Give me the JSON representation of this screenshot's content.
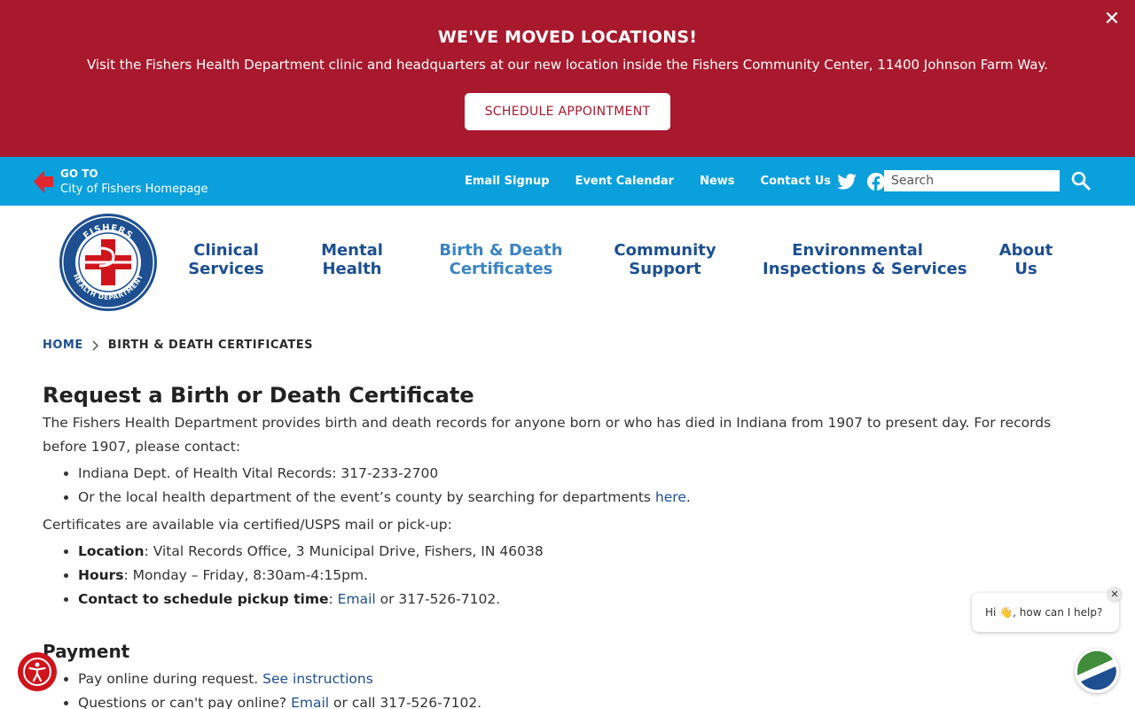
{
  "alert": {
    "title": "WE'VE MOVED LOCATIONS!",
    "text": "Visit the Fishers Health Department clinic and headquarters at our new location inside the Fishers Community Center, 11400 Johnson Farm Way.",
    "button_label": "SCHEDULE APPOINTMENT",
    "close_label": "✕"
  },
  "utility_bar": {
    "goto_top": "GO TO",
    "goto_bottom": "City of Fishers Homepage",
    "links": [
      "Email Signup",
      "Event Calendar",
      "News",
      "Contact Us"
    ],
    "social_icons": [
      "twitter-icon",
      "facebook-icon",
      "youtube-icon"
    ],
    "search_placeholder": "Search"
  },
  "logo": {
    "top_text": "FISHERS",
    "bottom_text": "HEALTH DEPARTMENT"
  },
  "nav": {
    "items": [
      {
        "line1": "Clinical",
        "line2": "Services"
      },
      {
        "line1": "Mental",
        "line2": "Health"
      },
      {
        "line1": "Birth & Death",
        "line2": "Certificates"
      },
      {
        "line1": "Community",
        "line2": "Support"
      },
      {
        "line1": "Environmental",
        "line2": "Inspections & Services"
      },
      {
        "line1": "About",
        "line2": "Us"
      }
    ],
    "active_index": 2
  },
  "breadcrumb": {
    "home": "HOME",
    "current": "BIRTH & DEATH CERTIFICATES"
  },
  "content": {
    "title": "Request a Birth or Death Certificate",
    "intro": "The Fishers Health Department provides birth and death records for anyone born or who has died in Indiana from 1907 to present day. For records before 1907, please contact:",
    "contacts": {
      "item1": "Indiana Dept. of Health Vital Records: 317-233-2700",
      "item2_text": "Or the local health department of the event’s county by searching for departments ",
      "item2_link": "here",
      "item2_end": "."
    },
    "availability": "Certificates are available via certified/USPS mail or pick-up:",
    "details": {
      "location_label": "Location",
      "location_value": ": Vital Records Office, 3 Municipal Drive, Fishers, IN 46038",
      "hours_label": "Hours",
      "hours_value": ": Monday – Friday, 8:30am-4:15pm.",
      "contact_label": "Contact to schedule pickup time",
      "contact_sep": ": ",
      "contact_link": "Email",
      "contact_end": " or 317-526-7102."
    },
    "payment": {
      "title": "Payment",
      "item1_text": "Pay online during request. ",
      "item1_link": "See instructions",
      "item2_text": "Questions or can't pay online? ",
      "item2_link": "Email",
      "item2_end": " or call 317-526-7102."
    }
  },
  "chat": {
    "greeting": "Hi 👋, how can I help?",
    "close_label": "✕"
  },
  "colors": {
    "alert_bg": "#a8192e",
    "utility_bg": "#0aa0dc",
    "nav_text": "#1d4f91",
    "nav_active": "#3b84c4",
    "link": "#1d4f91"
  }
}
